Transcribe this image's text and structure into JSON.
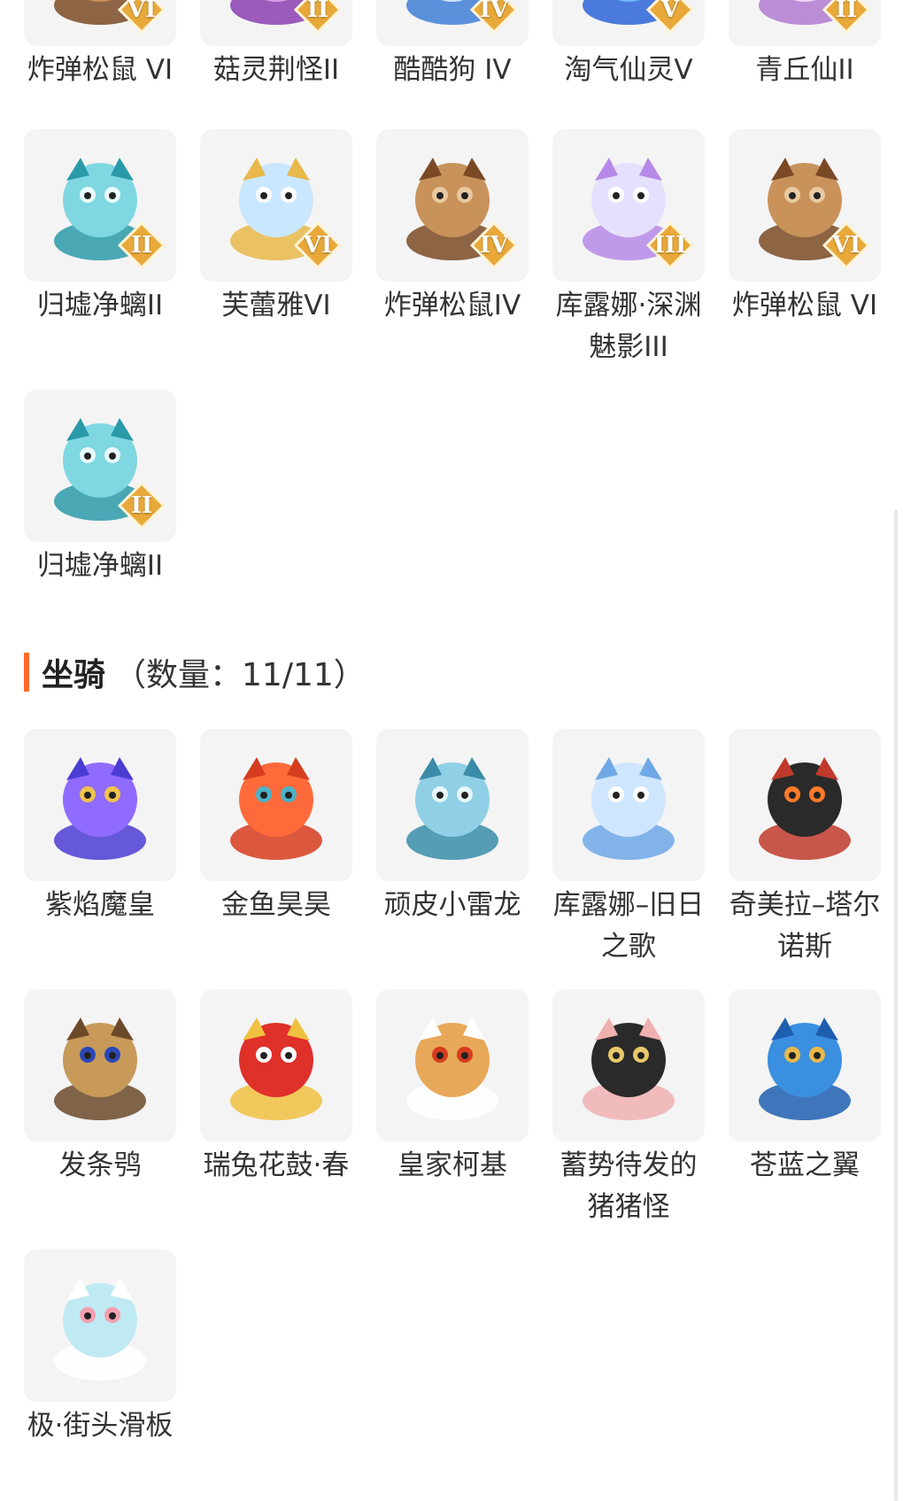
{
  "pets": {
    "top_row": [
      {
        "name": "炸弹松鼠 VI",
        "level": "VI",
        "icon": "squirrel-icon"
      },
      {
        "name": "菇灵荆怪II",
        "level": "II",
        "icon": "mushroom-sprite-icon"
      },
      {
        "name": "酷酷狗 IV",
        "level": "IV",
        "icon": "cool-dog-icon"
      },
      {
        "name": "淘气仙灵V",
        "level": "V",
        "icon": "blue-sprite-icon"
      },
      {
        "name": "青丘仙II",
        "level": "II",
        "icon": "fox-fairy-icon"
      }
    ],
    "row2": [
      {
        "name": "归墟净螭II",
        "level": "II",
        "icon": "dragon-icon"
      },
      {
        "name": "芙蕾雅VI",
        "level": "VI",
        "icon": "freya-icon"
      },
      {
        "name": "炸弹松鼠IV",
        "level": "IV",
        "icon": "squirrel-icon"
      },
      {
        "name": "库露娜·深渊魅影III",
        "level": "III",
        "icon": "kuluna-icon"
      },
      {
        "name": "炸弹松鼠 VI",
        "level": "VI",
        "icon": "squirrel-icon"
      }
    ],
    "row3": [
      {
        "name": "归墟净螭II",
        "level": "II",
        "icon": "dragon-icon"
      }
    ]
  },
  "mounts": {
    "title": "坐骑",
    "count_label": "（数量：11/11）",
    "items": [
      {
        "name": "紫焰魔皇",
        "icon": "phoenix-icon"
      },
      {
        "name": "金鱼昊昊",
        "icon": "goldfish-icon"
      },
      {
        "name": "顽皮小雷龙",
        "icon": "thunder-dragon-icon"
      },
      {
        "name": "库露娜–旧日之歌",
        "icon": "kuluna-song-icon"
      },
      {
        "name": "奇美拉–塔尔诺斯",
        "icon": "chimera-icon"
      },
      {
        "name": "发条鸮",
        "icon": "owl-icon"
      },
      {
        "name": "瑞兔花鼓·春",
        "icon": "rabbit-drum-icon"
      },
      {
        "name": "皇家柯基",
        "icon": "corgi-icon"
      },
      {
        "name": "蓄势待发的猪猪怪",
        "icon": "pig-icon"
      },
      {
        "name": "苍蓝之翼",
        "icon": "blue-dragon-icon"
      },
      {
        "name": "极·街头滑板",
        "icon": "skateboard-icon"
      }
    ]
  },
  "colors": {
    "accent": "#ff6a2a",
    "card_bg": "#f4f4f4",
    "badge": "#e8a93a"
  }
}
